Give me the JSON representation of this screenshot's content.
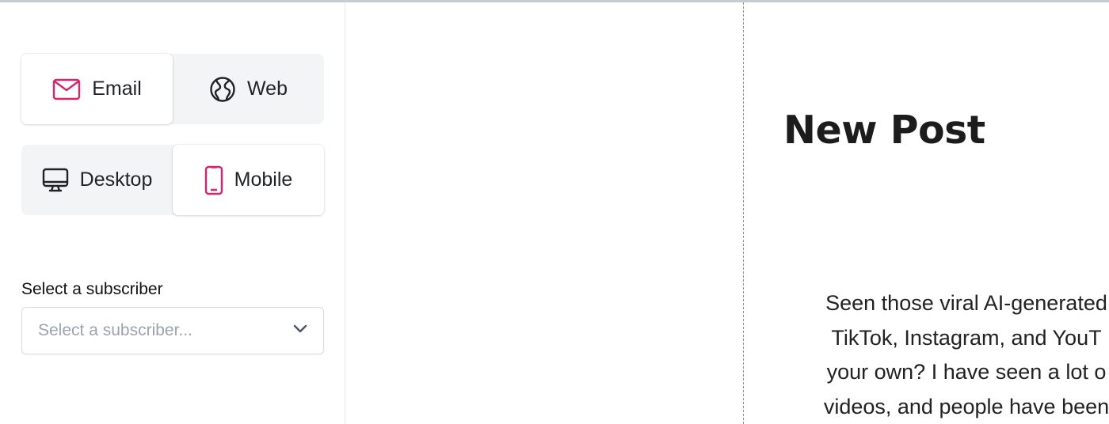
{
  "preview_modes": {
    "channel": [
      {
        "label": "Email",
        "icon": "email-icon",
        "active": true
      },
      {
        "label": "Web",
        "icon": "web-globe-icon",
        "active": false
      }
    ],
    "device": [
      {
        "label": "Desktop",
        "icon": "desktop-icon",
        "active": false
      },
      {
        "label": "Mobile",
        "icon": "mobile-icon",
        "active": true
      }
    ]
  },
  "subscriber": {
    "label": "Select a subscriber",
    "placeholder": "Select a subscriber..."
  },
  "post": {
    "title": "New Post",
    "body_lines": [
      "Seen those viral AI-generated",
      "TikTok, Instagram, and YouT",
      "your own? I have seen a lot o",
      "videos, and people have been"
    ]
  },
  "colors": {
    "accent": "#d6246e",
    "icon_dark": "#1f2328",
    "segment_bg": "#f3f4f6"
  }
}
